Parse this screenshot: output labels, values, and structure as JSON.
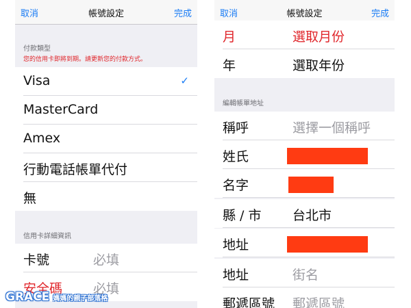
{
  "left_screen": {
    "nav": {
      "cancel": "取消",
      "title": "帳號設定",
      "done": "完成"
    },
    "payment_type": {
      "header": "付款類型",
      "warning": "您的信用卡即將到期。請更新您的付款方式。",
      "options": [
        "Visa",
        "MasterCard",
        "Amex",
        "行動電話帳單代付",
        "無"
      ],
      "selected": "Visa",
      "check_icon": "checkmark-icon"
    },
    "card_details": {
      "header": "信用卡詳細資訊",
      "card_number_label": "卡號",
      "card_number_placeholder": "必填",
      "security_code_label": "安全碼",
      "security_code_placeholder": "必填"
    }
  },
  "right_screen": {
    "nav": {
      "cancel": "取消",
      "title": "帳號設定",
      "done": "完成"
    },
    "expiry": {
      "month_label": "月",
      "month_value": "選取月份",
      "year_label": "年",
      "year_value": "選取年份"
    },
    "billing": {
      "header": "編輯帳單地址",
      "salutation_label": "稱呼",
      "salutation_placeholder": "選擇一個稱呼",
      "last_name_label": "姓氏",
      "first_name_label": "名字",
      "city_label": "縣 / 市",
      "city_value": "台北市",
      "address_label": "地址",
      "address2_label": "地址",
      "address2_placeholder": "街名",
      "postal_label": "郵遞區號",
      "postal_placeholder": "郵遞區號"
    }
  },
  "watermark": {
    "main": "GRACE",
    "sub": "媽媽的親子部落格"
  },
  "colors": {
    "accent": "#1a7cf5",
    "warning": "#e0262b",
    "redaction": "#ff3b12",
    "group_bg": "#efeff4"
  }
}
